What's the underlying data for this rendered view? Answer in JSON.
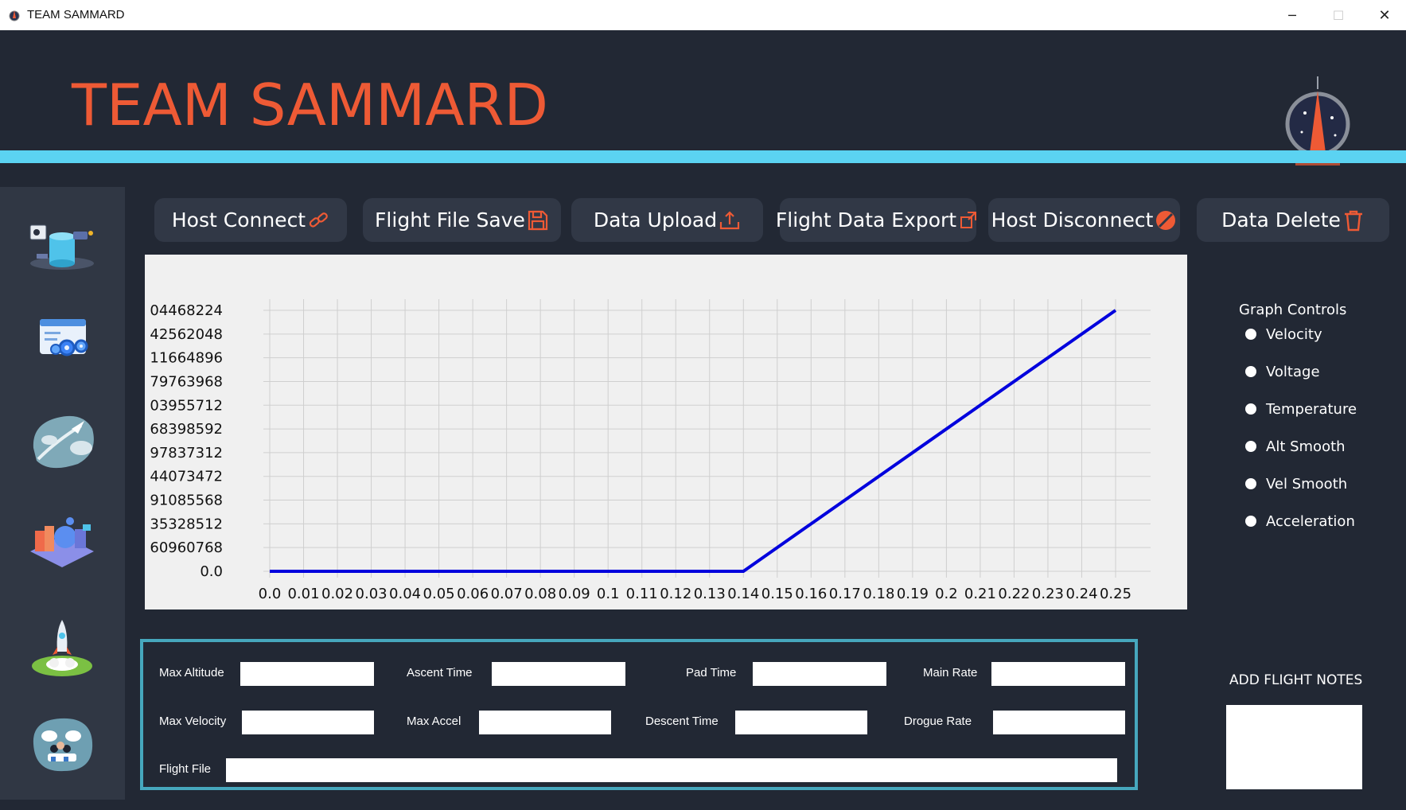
{
  "window": {
    "title": "TEAM SAMMARD",
    "minimize": "─",
    "maximize": "☐",
    "close": "✕"
  },
  "header": {
    "title": "TEAM SAMMARD",
    "accent_color": "#5bd3f2",
    "title_color": "#ee5a35"
  },
  "sidebar": {
    "items": [
      {
        "icon": "database-icon"
      },
      {
        "icon": "settings-window-icon"
      },
      {
        "icon": "rocket-flight-icon"
      },
      {
        "icon": "puzzle-build-icon"
      },
      {
        "icon": "rocket-launch-icon"
      },
      {
        "icon": "team-icon"
      }
    ]
  },
  "toolbar": {
    "host_connect": "Host Connect",
    "flight_file_save": "Flight File Save",
    "data_upload": "Data Upload",
    "flight_data_export": "Flight Data Export",
    "host_disconnect": "Host Disconnect",
    "data_delete": "Data Delete",
    "icon_color": "#ee5a35"
  },
  "chart_data": {
    "type": "line",
    "x": [
      0.0,
      0.14,
      0.25
    ],
    "y": [
      0.0,
      0.0,
      11
    ],
    "xlim": [
      0.0,
      0.25
    ],
    "ylim": [
      0,
      11
    ],
    "x_tick_labels": [
      "0.0",
      "0.01",
      "0.02",
      "0.03",
      "0.04",
      "0.05",
      "0.06",
      "0.07",
      "0.08",
      "0.09",
      "0.1",
      "0.11",
      "0.12",
      "0.13",
      "0.14",
      "0.15",
      "0.16",
      "0.17",
      "0.18",
      "0.19",
      "0.2",
      "0.21",
      "0.22",
      "0.23",
      "0.24",
      "0.25"
    ],
    "y_tick_labels": [
      "0.0",
      "60960768",
      "35328512",
      "91085568",
      "44073472",
      "97837312",
      "68398592",
      "03955712",
      "79763968",
      "11664896",
      "42562048",
      "04468224"
    ],
    "line_color": "#0000dd",
    "grid": true
  },
  "graph_controls": {
    "title": "Graph Controls",
    "options": [
      "Velocity",
      "Voltage",
      "Temperature",
      "Alt Smooth",
      "Vel Smooth",
      "Acceleration"
    ]
  },
  "stats": {
    "max_altitude": {
      "label": "Max Altitude",
      "value": ""
    },
    "ascent_time": {
      "label": "Ascent Time",
      "value": ""
    },
    "pad_time": {
      "label": "Pad Time",
      "value": ""
    },
    "main_rate": {
      "label": "Main Rate",
      "value": ""
    },
    "max_velocity": {
      "label": "Max Velocity",
      "value": ""
    },
    "max_accel": {
      "label": "Max Accel",
      "value": ""
    },
    "descent_time": {
      "label": "Descent Time",
      "value": ""
    },
    "drogue_rate": {
      "label": "Drogue Rate",
      "value": ""
    },
    "flight_file": {
      "label": "Flight File",
      "value": ""
    }
  },
  "notes": {
    "title": "ADD FLIGHT NOTES",
    "value": ""
  }
}
